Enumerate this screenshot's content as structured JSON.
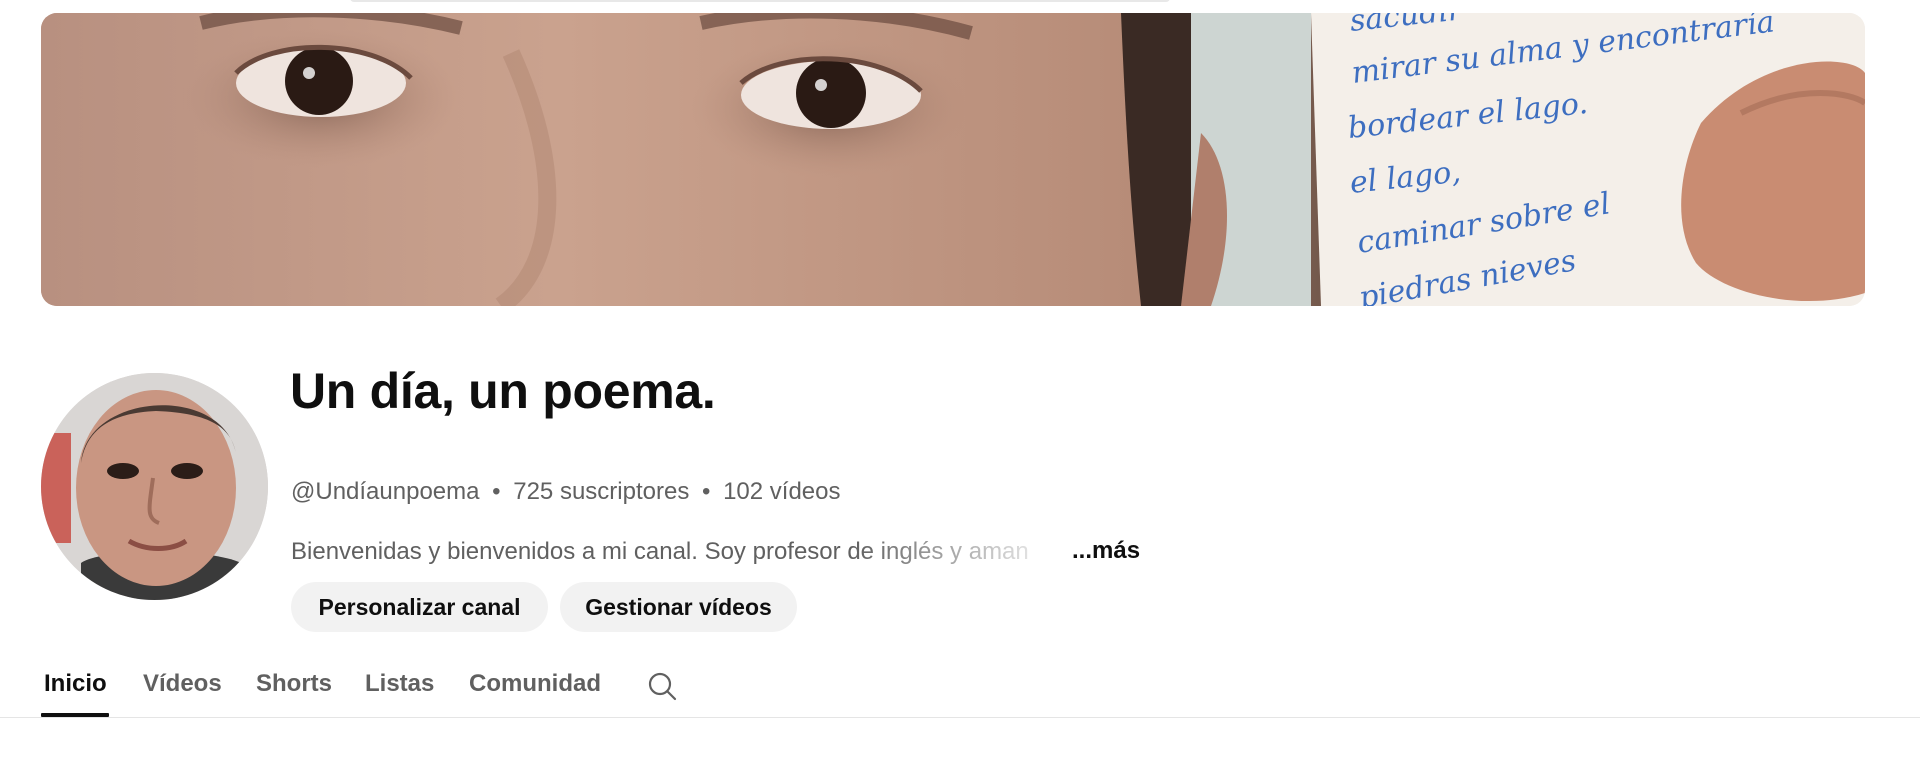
{
  "channel": {
    "title": "Un día, un poema.",
    "handle": "@Undíaunpoema",
    "subscribers": "725 suscriptores",
    "videos": "102 vídeos",
    "separator": "•",
    "description": "Bienvenidas y bienvenidos a mi canal. Soy profesor de inglés y aman",
    "more_label": "...más"
  },
  "banner": {
    "handwritten_lines": [
      "sacudir",
      "mirar su alma y encontraría",
      "bordear el lago.",
      "el lago,",
      "caminar sobre el",
      "piedras nieves"
    ],
    "ink_color": "#3d6ec0"
  },
  "actions": {
    "customize_label": "Personalizar canal",
    "manage_label": "Gestionar vídeos"
  },
  "tabs": [
    {
      "label": "Inicio",
      "active": true
    },
    {
      "label": "Vídeos",
      "active": false
    },
    {
      "label": "Shorts",
      "active": false
    },
    {
      "label": "Listas",
      "active": false
    },
    {
      "label": "Comunidad",
      "active": false
    }
  ],
  "icons": {
    "tab_search": "search-icon"
  },
  "colors": {
    "text_primary": "#0f0f0f",
    "text_secondary": "#606060",
    "button_bg": "#f2f2f2"
  }
}
